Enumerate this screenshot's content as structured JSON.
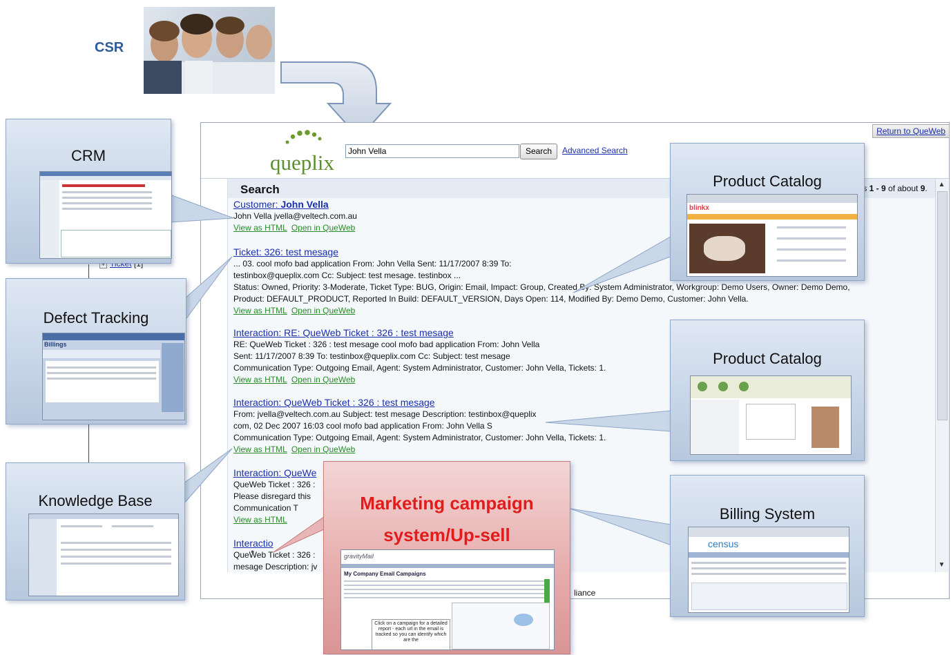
{
  "csr": {
    "label": "CSR"
  },
  "browser": {
    "search_value": "John Vella",
    "search_button": "Search",
    "advanced_link": "Advanced Search",
    "return_link": "Return to QueWeb",
    "logo": "queplix",
    "search_heading": "Search",
    "results_prefix": "ts ",
    "results_range": "1 - 9",
    "results_mid": " of about ",
    "results_total": "9",
    "results_suffix": ".",
    "footer_text": "liance"
  },
  "tree": {
    "ticket_label": "Ticket",
    "ticket_count": "[1]"
  },
  "results": [
    {
      "title_prefix": "Customer: ",
      "title_bold": "John Vella",
      "lines": [
        "John Vella jvella@veltech.com.au"
      ],
      "links": [
        "View as HTML",
        "Open in QueWeb"
      ]
    },
    {
      "title_prefix": "Ticket: 326: test mesage",
      "title_bold": "",
      "lines": [
        "... 03. cool mofo bad application From: John Vella Sent: 11/17/2007 8:39 To:",
        "testinbox@queplix.com Cc: Subject: test mesage. testinbox ...",
        "Status: Owned, Priority: 3-Moderate, Ticket Type: BUG, Origin: Email, Impact: Group, Created By: System Administrator, Workgroup: Demo Users, Owner: Demo Demo,",
        "Product: DEFAULT_PRODUCT, Reported In Build: DEFAULT_VERSION, Days Open: 114, Modified By: Demo Demo, Customer: John Vella."
      ],
      "links": [
        "View as HTML",
        "Open in QueWeb"
      ]
    },
    {
      "title_prefix": "Interaction: RE: QueWeb Ticket : 326 : test mesage",
      "title_bold": "",
      "lines": [
        "RE: QueWeb Ticket : 326 : test mesage cool mofo bad application From: John Vella",
        "Sent: 11/17/2007 8:39 To: testinbox@queplix.com Cc: Subject: test mesage",
        "Communication Type: Outgoing Email, Agent: System Administrator, Customer: John Vella, Tickets: 1."
      ],
      "links": [
        "View as HTML",
        "Open in QueWeb"
      ]
    },
    {
      "title_prefix": "Interaction: QueWeb Ticket : 326 : test mesage",
      "title_bold": "",
      "lines": [
        "From: jvella@veltech.com.au Subject: test mesage Description: testinbox@queplix",
        "com, 02 Dec 2007 16:03 cool mofo bad application From: John Vella S",
        "Communication Type: Outgoing Email, Agent: System Administrator, Customer: John Vella, Tickets: 1."
      ],
      "links": [
        "View as HTML",
        "Open in QueWeb"
      ]
    },
    {
      "title_prefix": "Interaction: QueWe",
      "title_bold": "",
      "lines": [
        "QueWeb Ticket : 326 :",
        "Please disregard this",
        "Communication T"
      ],
      "links": [
        "View as HTML"
      ]
    },
    {
      "title_prefix": "Interactio",
      "title_bold": "",
      "lines": [
        "QueWeb Ticket : 326 :",
        "mesage Description: jv"
      ],
      "links": []
    }
  ],
  "callouts": {
    "crm": "CRM",
    "defect": "Defect Tracking",
    "kb": "Knowledge Base",
    "catalog1": "Product Catalog",
    "catalog2": "Product Catalog",
    "billing": "Billing System",
    "marketing_line1": "Marketing campaign",
    "marketing_line2": "system/Up-sell"
  },
  "thumbs": {
    "defect_header": "Billings",
    "census_logo": "census",
    "gravity_logo": "gravityMail",
    "gravity_heading": "My Company Email Campaigns",
    "gravity_note": "Click on a campaign for a detailed report - each url in the email is tracked so you can identify which are the"
  },
  "colors": {
    "accent_blue": "#2e5b9a",
    "link": "#1a2fb0",
    "link_green": "#2a8a2a",
    "marketing_red": "#e21b1b",
    "callout_fill": "#c8d6e8"
  }
}
